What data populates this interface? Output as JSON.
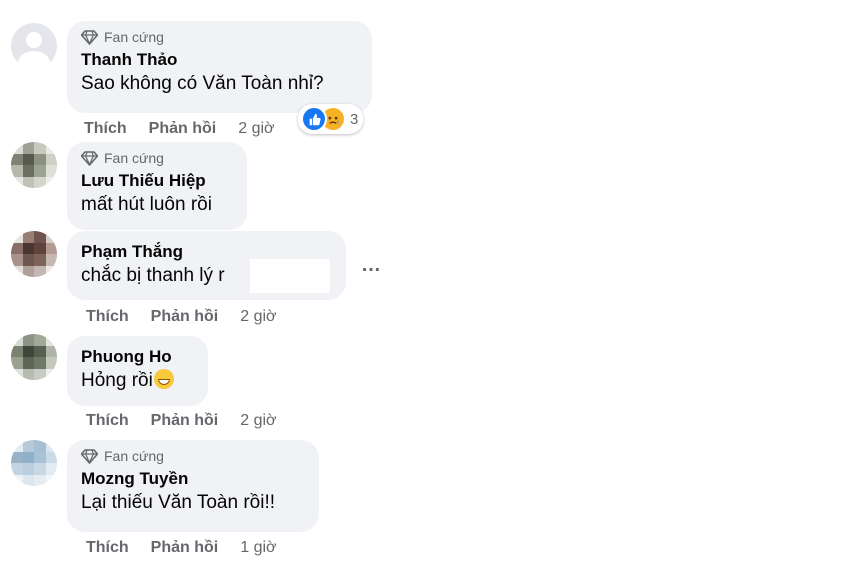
{
  "badge_label": "Fan cứng",
  "actions": {
    "like": "Thích",
    "reply": "Phản hồi"
  },
  "more_icon": "…",
  "comments": [
    {
      "name": "Thanh Thảo",
      "text": "Sao không có Văn Toàn nhỉ?",
      "time": "2 giờ",
      "has_badge": true,
      "reaction_count": "3"
    },
    {
      "name": "Lưu Thiếu Hiệp",
      "text": "mất hút luôn rồi",
      "has_badge": true
    },
    {
      "name": "Phạm Thắng",
      "text": "chắc bị thanh lý r",
      "time": "2 giờ"
    },
    {
      "name": "Phuong Ho",
      "text": "Hỏng rồi",
      "time": "2 giờ"
    },
    {
      "name": "Mozng Tuyền",
      "text": "Lại thiếu Văn Toàn rồi!!",
      "time": "1 giờ",
      "has_badge": true
    }
  ],
  "colors": {
    "bubble": "#f0f2f5",
    "meta": "#65676b",
    "like": "#1877f2",
    "sad": "#f7b125"
  }
}
